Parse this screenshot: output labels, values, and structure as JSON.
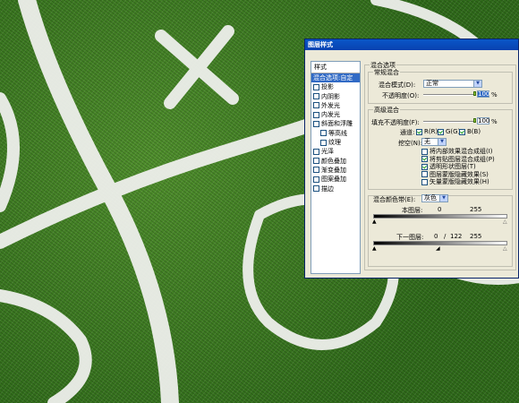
{
  "dialog": {
    "title": "图层样式",
    "left_panel": {
      "header": "样式",
      "items": [
        {
          "label": "混合选项:自定",
          "checkbox": false,
          "checked": false,
          "selected": true,
          "indent": false
        },
        {
          "label": "投影",
          "checkbox": true,
          "checked": false,
          "selected": false,
          "indent": false
        },
        {
          "label": "内阴影",
          "checkbox": true,
          "checked": false,
          "selected": false,
          "indent": false
        },
        {
          "label": "外发光",
          "checkbox": true,
          "checked": false,
          "selected": false,
          "indent": false
        },
        {
          "label": "内发光",
          "checkbox": true,
          "checked": false,
          "selected": false,
          "indent": false
        },
        {
          "label": "斜面和浮雕",
          "checkbox": true,
          "checked": false,
          "selected": false,
          "indent": false
        },
        {
          "label": "等高线",
          "checkbox": true,
          "checked": false,
          "selected": false,
          "indent": true
        },
        {
          "label": "纹理",
          "checkbox": true,
          "checked": false,
          "selected": false,
          "indent": true
        },
        {
          "label": "光泽",
          "checkbox": true,
          "checked": false,
          "selected": false,
          "indent": false
        },
        {
          "label": "颜色叠加",
          "checkbox": true,
          "checked": false,
          "selected": false,
          "indent": false
        },
        {
          "label": "渐变叠加",
          "checkbox": true,
          "checked": false,
          "selected": false,
          "indent": false
        },
        {
          "label": "图案叠加",
          "checkbox": true,
          "checked": false,
          "selected": false,
          "indent": false
        },
        {
          "label": "描边",
          "checkbox": true,
          "checked": false,
          "selected": false,
          "indent": false
        }
      ]
    },
    "blend_options": {
      "section_title": "混合选项",
      "general": {
        "group_title": "常规混合",
        "mode_label": "混合模式(D):",
        "mode_value": "正常",
        "opacity_label": "不透明度(O):",
        "opacity_value": "100",
        "opacity_unit": "%"
      },
      "advanced": {
        "group_title": "高级混合",
        "fill_label": "填充不透明度(F):",
        "fill_value": "100",
        "fill_unit": "%",
        "channels_label": "通道:",
        "channels": [
          {
            "label": "R(R)",
            "checked": true
          },
          {
            "label": "G(G)",
            "checked": true
          },
          {
            "label": "B(B)",
            "checked": true
          }
        ],
        "knockout_label": "挖空(N):",
        "knockout_value": "无",
        "options": [
          {
            "label": "将内部效果混合成组(I)",
            "checked": false
          },
          {
            "label": "将剪贴图层混合成组(P)",
            "checked": true
          },
          {
            "label": "透明形状图层(T)",
            "checked": true
          },
          {
            "label": "图层蒙版隐藏效果(S)",
            "checked": false
          },
          {
            "label": "矢量蒙版隐藏效果(H)",
            "checked": false
          }
        ]
      },
      "blend_if": {
        "label": "混合颜色带(E):",
        "value": "灰色",
        "this_layer_label": "本图层:",
        "this_layer_values": [
          "0",
          "255"
        ],
        "underlying_label": "下一图层:",
        "underlying_values": [
          "0",
          "/",
          "122",
          "255"
        ]
      }
    }
  }
}
